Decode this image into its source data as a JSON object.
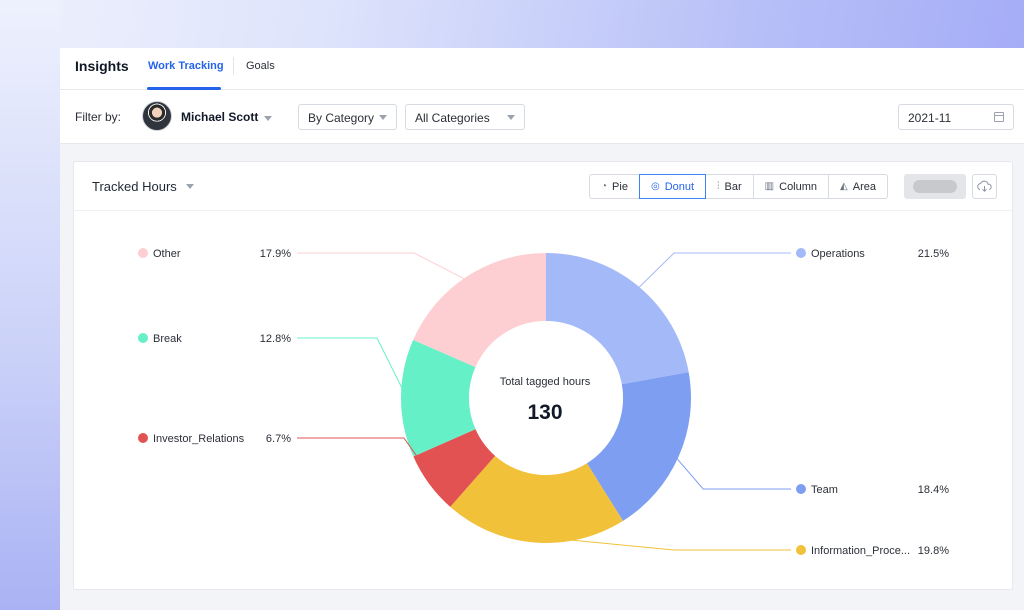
{
  "header": {
    "title": "Insights",
    "tabs": [
      {
        "label": "Work Tracking",
        "active": true
      },
      {
        "label": "Goals",
        "active": false
      }
    ]
  },
  "filters": {
    "label": "Filter by:",
    "user": "Michael Scott",
    "group_by": "By Category",
    "category": "All Categories",
    "date": "2021-11"
  },
  "card": {
    "title": "Tracked Hours",
    "chart_types": [
      {
        "label": "Pie",
        "icon": "pie-icon",
        "active": false
      },
      {
        "label": "Donut",
        "icon": "donut-icon",
        "active": true
      },
      {
        "label": "Bar",
        "icon": "bar-icon",
        "active": false
      },
      {
        "label": "Column",
        "icon": "column-icon",
        "active": false
      },
      {
        "label": "Area",
        "icon": "area-icon",
        "active": false
      }
    ]
  },
  "chart_data": {
    "type": "pie",
    "donut": true,
    "center_label": "Total tagged hours",
    "center_value": "130",
    "slices": [
      {
        "name": "Operations",
        "percent": 21.5,
        "label": "21.5%",
        "color": "#a4b9f8"
      },
      {
        "name": "Team",
        "percent": 18.4,
        "label": "18.4%",
        "color": "#7d9ef1"
      },
      {
        "name": "Information_Proce...",
        "percent": 19.8,
        "label": "19.8%",
        "color": "#f2c13a"
      },
      {
        "name": "Investor_Relations",
        "percent": 6.7,
        "label": "6.7%",
        "color": "#e25252"
      },
      {
        "name": "Break",
        "percent": 12.8,
        "label": "12.8%",
        "color": "#66f0c8"
      },
      {
        "name": "Other",
        "percent": 17.9,
        "label": "17.9%",
        "color": "#fecfd2"
      }
    ]
  }
}
